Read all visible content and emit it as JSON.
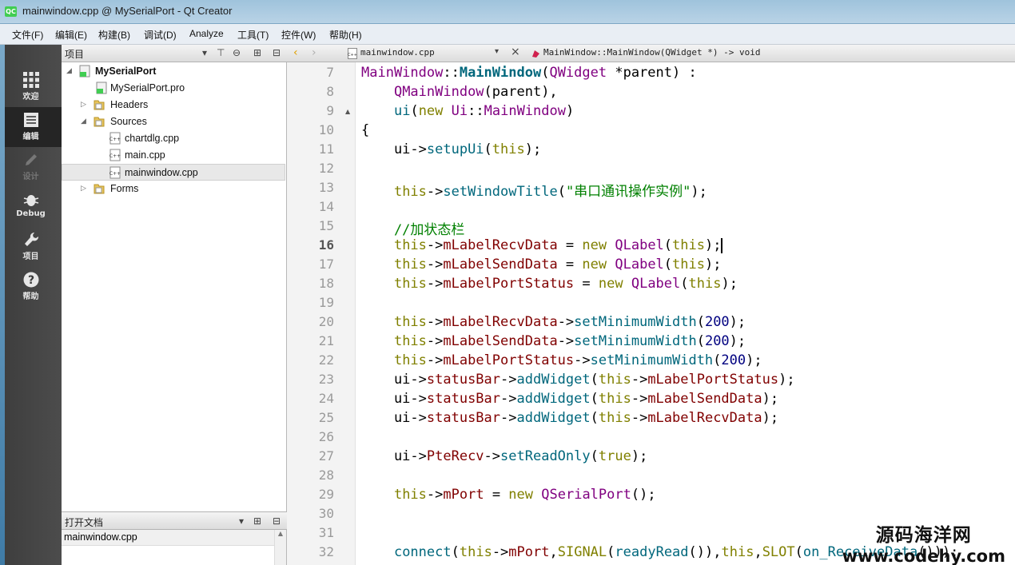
{
  "window": {
    "title": "mainwindow.cpp @ MySerialPort - Qt Creator",
    "app_icon_label": "QC"
  },
  "menu": [
    "文件(F)",
    "编辑(E)",
    "构建(B)",
    "调试(D)",
    "Analyze",
    "工具(T)",
    "控件(W)",
    "帮助(H)"
  ],
  "modes": [
    {
      "label": "欢迎",
      "icon": "grid-icon",
      "state": "normal"
    },
    {
      "label": "编辑",
      "icon": "document-icon",
      "state": "active"
    },
    {
      "label": "设计",
      "icon": "pencil-icon",
      "state": "disabled"
    },
    {
      "label": "Debug",
      "icon": "bug-icon",
      "state": "normal"
    },
    {
      "label": "项目",
      "icon": "wrench-icon",
      "state": "normal"
    },
    {
      "label": "帮助",
      "icon": "help-icon",
      "state": "normal"
    }
  ],
  "project_pane": {
    "title": "项目",
    "tree": [
      {
        "label": "MySerialPort",
        "level": 0,
        "expanded": true,
        "icon": "project-icon",
        "bold": true
      },
      {
        "label": "MySerialPort.pro",
        "level": 1,
        "icon": "pro-file-icon"
      },
      {
        "label": "Headers",
        "level": 1,
        "expanded": false,
        "icon": "folder-icon"
      },
      {
        "label": "Sources",
        "level": 1,
        "expanded": true,
        "icon": "folder-icon"
      },
      {
        "label": "chartdlg.cpp",
        "level": 2,
        "icon": "cpp-file-icon"
      },
      {
        "label": "main.cpp",
        "level": 2,
        "icon": "cpp-file-icon"
      },
      {
        "label": "mainwindow.cpp",
        "level": 2,
        "icon": "cpp-file-icon",
        "selected": true
      },
      {
        "label": "Forms",
        "level": 1,
        "expanded": false,
        "icon": "folder-icon"
      }
    ]
  },
  "open_docs": {
    "title": "打开文档",
    "items": [
      "mainwindow.cpp"
    ]
  },
  "editor_toolbar": {
    "file": "mainwindow.cpp",
    "symbol": "MainWindow::MainWindow(QWidget *) -> void"
  },
  "editor": {
    "current_line": 16,
    "lines": [
      {
        "n": "7",
        "text": "MainWindow::MainWindow(QWidget *parent) :"
      },
      {
        "n": "8",
        "text": "    QMainWindow(parent),"
      },
      {
        "n": "9",
        "text": "    ui(new Ui::MainWindow)",
        "fold": true
      },
      {
        "n": "10",
        "text": "{"
      },
      {
        "n": "11",
        "text": "    ui->setupUi(this);"
      },
      {
        "n": "12",
        "text": ""
      },
      {
        "n": "13",
        "text": "    this->setWindowTitle(\"串口通讯操作实例\");"
      },
      {
        "n": "14",
        "text": ""
      },
      {
        "n": "15",
        "text": "    //加状态栏"
      },
      {
        "n": "16",
        "text": "    this->mLabelRecvData = new QLabel(this);"
      },
      {
        "n": "17",
        "text": "    this->mLabelSendData = new QLabel(this);"
      },
      {
        "n": "18",
        "text": "    this->mLabelPortStatus = new QLabel(this);"
      },
      {
        "n": "19",
        "text": ""
      },
      {
        "n": "20",
        "text": "    this->mLabelRecvData->setMinimumWidth(200);"
      },
      {
        "n": "21",
        "text": "    this->mLabelSendData->setMinimumWidth(200);"
      },
      {
        "n": "22",
        "text": "    this->mLabelPortStatus->setMinimumWidth(200);"
      },
      {
        "n": "23",
        "text": "    ui->statusBar->addWidget(this->mLabelPortStatus);"
      },
      {
        "n": "24",
        "text": "    ui->statusBar->addWidget(this->mLabelSendData);"
      },
      {
        "n": "25",
        "text": "    ui->statusBar->addWidget(this->mLabelRecvData);"
      },
      {
        "n": "26",
        "text": ""
      },
      {
        "n": "27",
        "text": "    ui->PteRecv->setReadOnly(true);"
      },
      {
        "n": "28",
        "text": ""
      },
      {
        "n": "29",
        "text": "    this->mPort = new QSerialPort();"
      },
      {
        "n": "30",
        "text": ""
      },
      {
        "n": "31",
        "text": ""
      },
      {
        "n": "32",
        "text": "    connect(this->mPort,SIGNAL(readyRead()),this,SLOT(on_ReceiveData()));"
      }
    ]
  },
  "watermark": {
    "line1": "源码海洋网",
    "line2": "www.codehy.com"
  },
  "colors": {
    "keyword": "#808000",
    "type": "#800080",
    "function": "#00677c",
    "string": "#008000",
    "number": "#000080"
  }
}
